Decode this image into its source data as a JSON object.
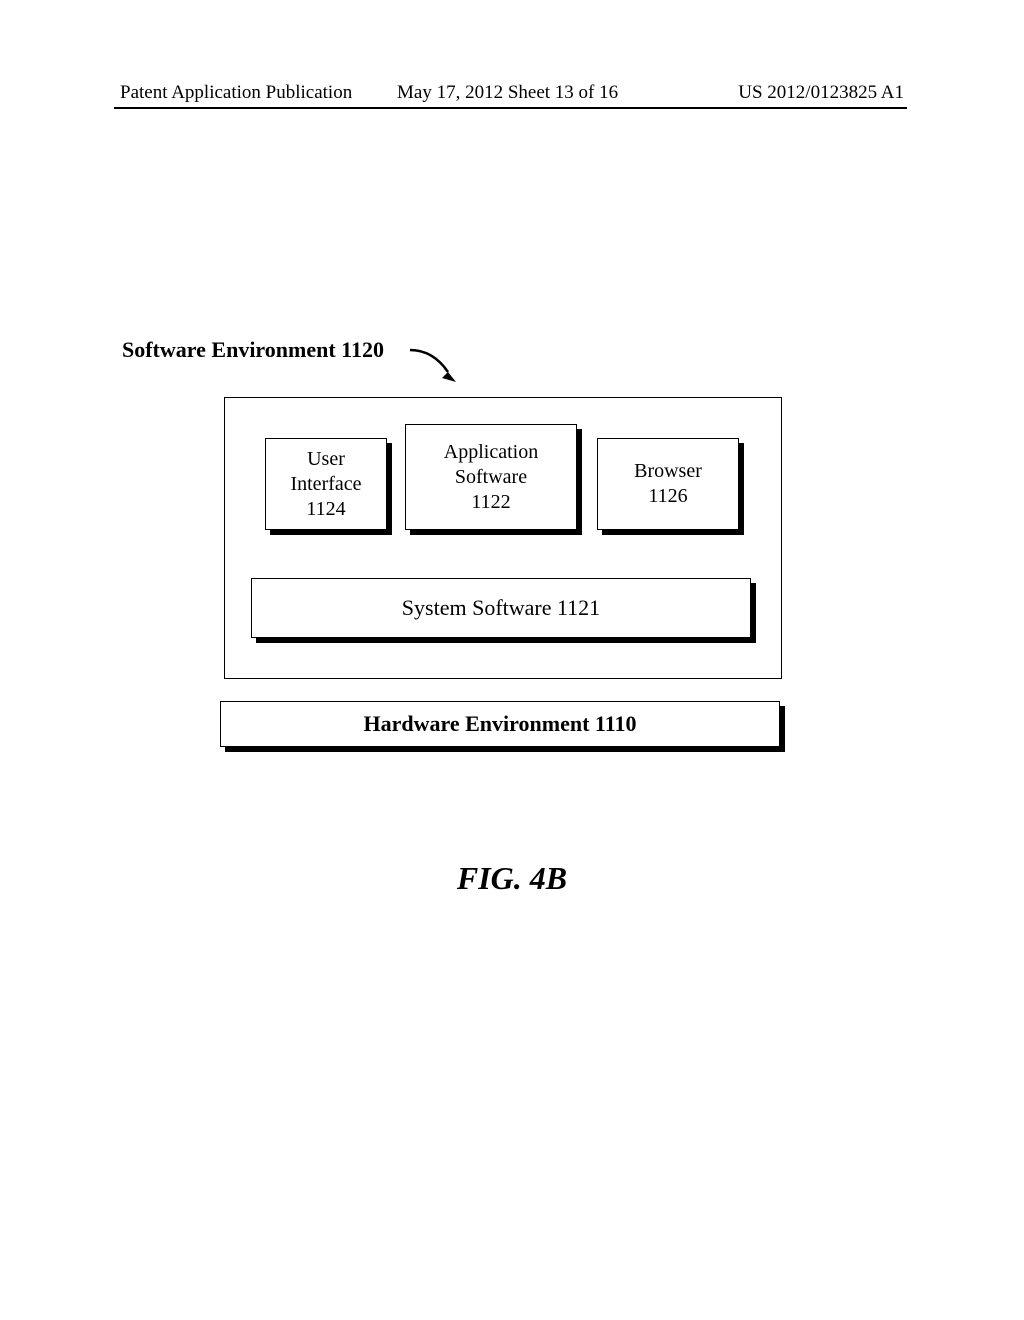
{
  "header": {
    "left": "Patent Application Publication",
    "middle": "May 17, 2012  Sheet 13 of 16",
    "right": "US 2012/0123825 A1"
  },
  "labels": {
    "software_env": "Software Environment 1120"
  },
  "boxes": {
    "user_interface": "User\nInterface\n1124",
    "application_software": "Application\nSoftware\n1122",
    "browser": "Browser\n1126",
    "system_software": "System Software 1121",
    "hardware_env": "Hardware Environment 1110"
  },
  "figure_caption": "FIG. 4B"
}
